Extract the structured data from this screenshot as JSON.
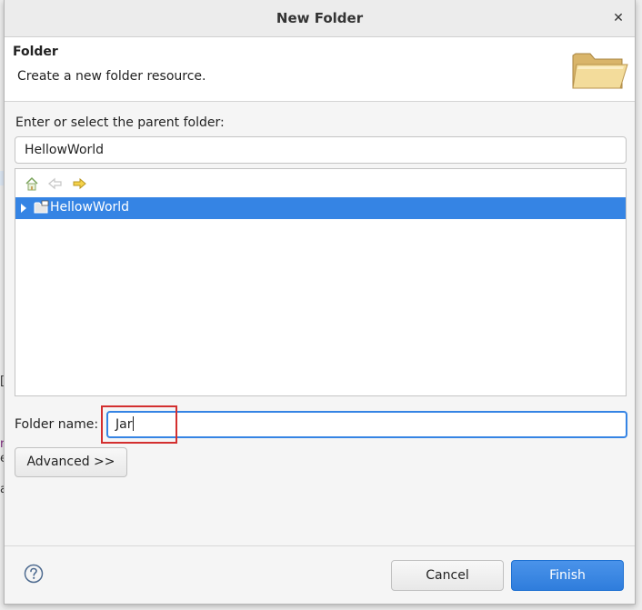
{
  "window": {
    "title": "New Folder",
    "close_glyph": "✕"
  },
  "banner": {
    "title": "Folder",
    "description": "Create a new folder resource."
  },
  "parent": {
    "label": "Enter or select the parent folder:",
    "value": "HellowWorld"
  },
  "tree": {
    "items": [
      {
        "label": "HellowWorld",
        "selected": true,
        "expanded": false
      }
    ]
  },
  "folder_name": {
    "label": "Folder name:",
    "value": "Jar"
  },
  "buttons": {
    "advanced": "Advanced >>",
    "cancel": "Cancel",
    "finish": "Finish"
  },
  "background_glyphs": {
    "a": "[",
    "b": "n",
    "c": "e",
    "d": "a"
  },
  "colors": {
    "accent": "#3584e4",
    "highlight_box": "#d32f2f"
  }
}
